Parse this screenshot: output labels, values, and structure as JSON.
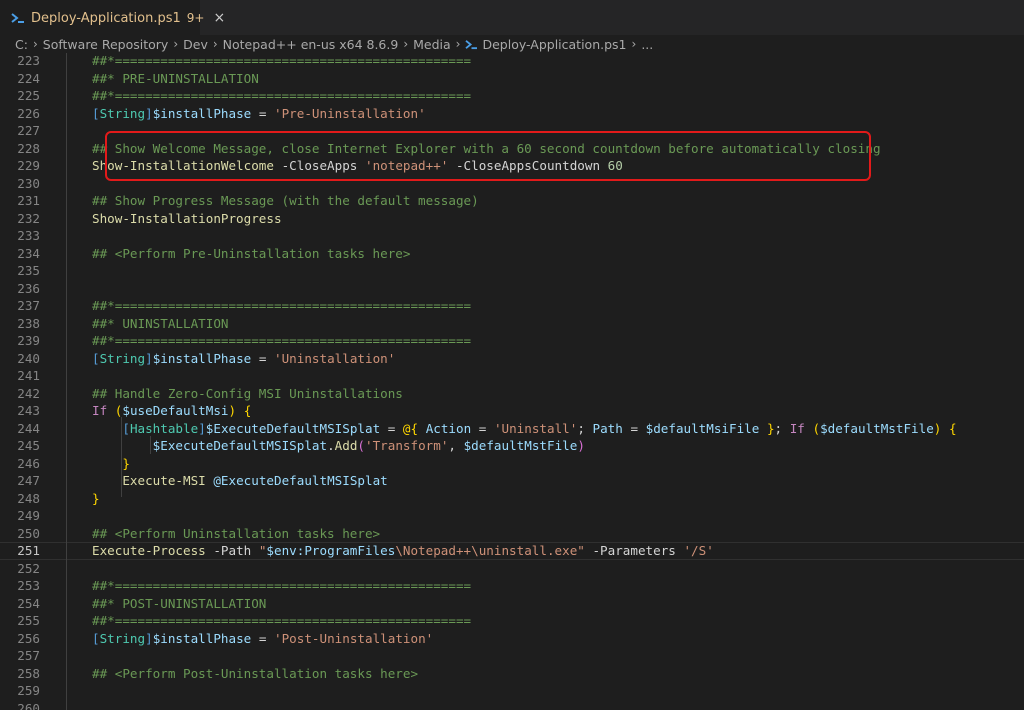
{
  "tab": {
    "title": "Deploy-Application.ps1",
    "badge": "9+",
    "close": "×",
    "icon": "powershell-icon"
  },
  "breadcrumb": {
    "items": [
      "C:",
      "Software Repository",
      "Dev",
      "Notepad++ en-us x64 8.6.9",
      "Media",
      "Deploy-Application.ps1",
      "..."
    ]
  },
  "colors": {
    "background": "#1e1e1e",
    "comment": "#6a9955",
    "string": "#ce9178",
    "variable": "#9cdcfe",
    "highlight_border": "#e21a1a"
  },
  "editor": {
    "active_line": 251,
    "highlighted_lines": [
      228,
      229
    ],
    "lines": [
      {
        "n": "223",
        "tokens": [
          [
            "com",
            "##*==============================================="
          ]
        ]
      },
      {
        "n": "224",
        "tokens": [
          [
            "com",
            "##* PRE-UNINSTALLATION"
          ]
        ]
      },
      {
        "n": "225",
        "tokens": [
          [
            "com",
            "##*==============================================="
          ]
        ]
      },
      {
        "n": "226",
        "tokens": [
          [
            "br",
            "["
          ],
          [
            "type",
            "String"
          ],
          [
            "br",
            "]"
          ],
          [
            "var",
            "$installPhase"
          ],
          [
            "op",
            " = "
          ],
          [
            "str",
            "'Pre-Uninstallation'"
          ]
        ]
      },
      {
        "n": "227",
        "tokens": []
      },
      {
        "n": "228",
        "tokens": [
          [
            "com",
            "## Show Welcome Message, close Internet Explorer with a 60 second countdown before automatically closing"
          ]
        ]
      },
      {
        "n": "229",
        "tokens": [
          [
            "fn",
            "Show-InstallationWelcome"
          ],
          [
            "op",
            " -CloseApps "
          ],
          [
            "str",
            "'notepad++'"
          ],
          [
            "op",
            " -CloseAppsCountdown "
          ],
          [
            "num",
            "60"
          ]
        ]
      },
      {
        "n": "230",
        "tokens": []
      },
      {
        "n": "231",
        "tokens": [
          [
            "com",
            "## Show Progress Message (with the default message)"
          ]
        ]
      },
      {
        "n": "232",
        "tokens": [
          [
            "fn",
            "Show-InstallationProgress"
          ]
        ]
      },
      {
        "n": "233",
        "tokens": []
      },
      {
        "n": "234",
        "tokens": [
          [
            "com",
            "## <Perform Pre-Uninstallation tasks here>"
          ]
        ]
      },
      {
        "n": "235",
        "tokens": []
      },
      {
        "n": "236",
        "tokens": []
      },
      {
        "n": "237",
        "tokens": [
          [
            "com",
            "##*==============================================="
          ]
        ]
      },
      {
        "n": "238",
        "tokens": [
          [
            "com",
            "##* UNINSTALLATION"
          ]
        ]
      },
      {
        "n": "239",
        "tokens": [
          [
            "com",
            "##*==============================================="
          ]
        ]
      },
      {
        "n": "240",
        "tokens": [
          [
            "br",
            "["
          ],
          [
            "type",
            "String"
          ],
          [
            "br",
            "]"
          ],
          [
            "var",
            "$installPhase"
          ],
          [
            "op",
            " = "
          ],
          [
            "str",
            "'Uninstallation'"
          ]
        ]
      },
      {
        "n": "241",
        "tokens": []
      },
      {
        "n": "242",
        "tokens": [
          [
            "com",
            "## Handle Zero-Config MSI Uninstallations"
          ]
        ]
      },
      {
        "n": "243",
        "tokens": [
          [
            "key",
            "If"
          ],
          [
            "op",
            " "
          ],
          [
            "par",
            "("
          ],
          [
            "var",
            "$useDefaultMsi"
          ],
          [
            "par",
            ")"
          ],
          [
            "op",
            " "
          ],
          [
            "par",
            "{"
          ]
        ]
      },
      {
        "n": "244",
        "tokens": [
          [
            "op",
            "    "
          ],
          [
            "br",
            "["
          ],
          [
            "type",
            "Hashtable"
          ],
          [
            "br",
            "]"
          ],
          [
            "var",
            "$ExecuteDefaultMSISplat"
          ],
          [
            "op",
            " = "
          ],
          [
            "par",
            "@{"
          ],
          [
            "op",
            " "
          ],
          [
            "var",
            "Action"
          ],
          [
            "op",
            " = "
          ],
          [
            "str",
            "'Uninstall'"
          ],
          [
            "op",
            "; "
          ],
          [
            "var",
            "Path"
          ],
          [
            "op",
            " = "
          ],
          [
            "var",
            "$defaultMsiFile"
          ],
          [
            "op",
            " "
          ],
          [
            "par",
            "}"
          ],
          [
            "op",
            "; "
          ],
          [
            "key",
            "If"
          ],
          [
            "op",
            " "
          ],
          [
            "par",
            "("
          ],
          [
            "var",
            "$defaultMstFile"
          ],
          [
            "par",
            ")"
          ],
          [
            "op",
            " "
          ],
          [
            "par",
            "{"
          ]
        ]
      },
      {
        "n": "245",
        "tokens": [
          [
            "op",
            "        "
          ],
          [
            "var",
            "$ExecuteDefaultMSISplat"
          ],
          [
            "op",
            "."
          ],
          [
            "fn",
            "Add"
          ],
          [
            "par2",
            "("
          ],
          [
            "str",
            "'Transform'"
          ],
          [
            "op",
            ", "
          ],
          [
            "var",
            "$defaultMstFile"
          ],
          [
            "par2",
            ")"
          ]
        ]
      },
      {
        "n": "246",
        "tokens": [
          [
            "op",
            "    "
          ],
          [
            "par",
            "}"
          ]
        ]
      },
      {
        "n": "247",
        "tokens": [
          [
            "op",
            "    "
          ],
          [
            "fn",
            "Execute-MSI"
          ],
          [
            "op",
            " "
          ],
          [
            "var",
            "@ExecuteDefaultMSISplat"
          ]
        ]
      },
      {
        "n": "248",
        "tokens": [
          [
            "par",
            "}"
          ]
        ]
      },
      {
        "n": "249",
        "tokens": []
      },
      {
        "n": "250",
        "tokens": [
          [
            "com",
            "## <Perform Uninstallation tasks here>"
          ]
        ]
      },
      {
        "n": "251",
        "tokens": [
          [
            "fn",
            "Execute-Process"
          ],
          [
            "op",
            " -Path "
          ],
          [
            "str",
            "\""
          ],
          [
            "var",
            "$env:ProgramFiles"
          ],
          [
            "str",
            "\\Notepad++\\uninstall.exe\""
          ],
          [
            "op",
            " -Parameters "
          ],
          [
            "str",
            "'/S'"
          ]
        ]
      },
      {
        "n": "252",
        "tokens": []
      },
      {
        "n": "253",
        "tokens": [
          [
            "com",
            "##*==============================================="
          ]
        ]
      },
      {
        "n": "254",
        "tokens": [
          [
            "com",
            "##* POST-UNINSTALLATION"
          ]
        ]
      },
      {
        "n": "255",
        "tokens": [
          [
            "com",
            "##*==============================================="
          ]
        ]
      },
      {
        "n": "256",
        "tokens": [
          [
            "br",
            "["
          ],
          [
            "type",
            "String"
          ],
          [
            "br",
            "]"
          ],
          [
            "var",
            "$installPhase"
          ],
          [
            "op",
            " = "
          ],
          [
            "str",
            "'Post-Uninstallation'"
          ]
        ]
      },
      {
        "n": "257",
        "tokens": []
      },
      {
        "n": "258",
        "tokens": [
          [
            "com",
            "## <Perform Post-Uninstallation tasks here>"
          ]
        ]
      },
      {
        "n": "259",
        "tokens": []
      },
      {
        "n": "260",
        "tokens": []
      }
    ]
  }
}
